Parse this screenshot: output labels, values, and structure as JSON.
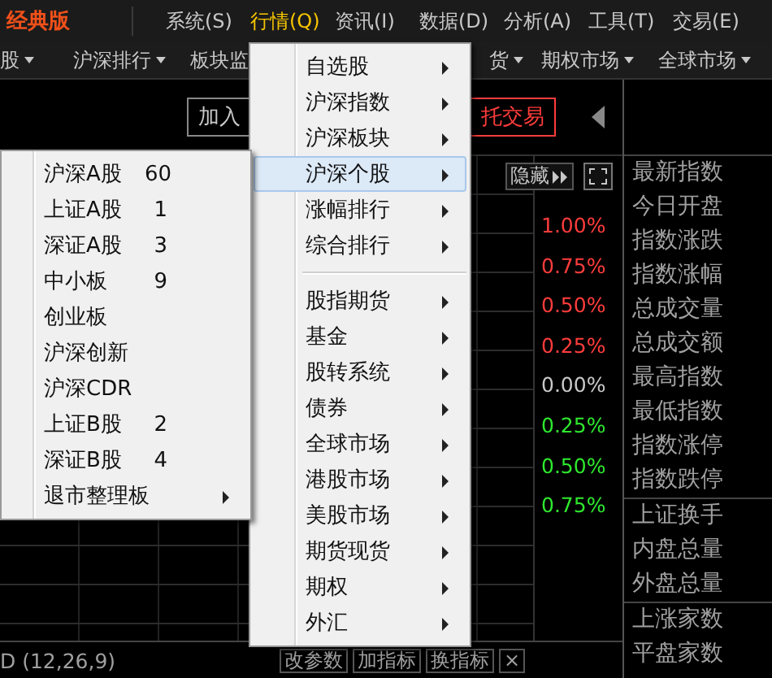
{
  "app": {
    "edition": "经典版"
  },
  "menu_bar": [
    {
      "label": "系统(S)",
      "selected": false
    },
    {
      "label": "行情(Q)",
      "selected": true
    },
    {
      "label": "资讯(I)",
      "selected": false
    },
    {
      "label": "数据(D)",
      "selected": false
    },
    {
      "label": "分析(A)",
      "selected": false
    },
    {
      "label": "工具(T)",
      "selected": false
    },
    {
      "label": "交易(E)",
      "selected": false
    }
  ],
  "toolbar": [
    {
      "label": "股",
      "dropdown": true
    },
    {
      "label": "沪深排行",
      "dropdown": true
    },
    {
      "label": "板块监",
      "dropdown": false
    },
    {
      "label": "货",
      "dropdown": true
    },
    {
      "label": "期权市场",
      "dropdown": true
    },
    {
      "label": "全球市场",
      "dropdown": true
    }
  ],
  "actions": [
    {
      "label": "加入",
      "kind": "plain"
    },
    {
      "label": "托交易",
      "kind": "trade"
    }
  ],
  "chart": {
    "hide_button": "隐藏",
    "axis_labels": [
      {
        "text": "1.00%",
        "color": "#ff3c3c"
      },
      {
        "text": "0.75%",
        "color": "#ff3c3c"
      },
      {
        "text": "0.50%",
        "color": "#ff3c3c"
      },
      {
        "text": "0.25%",
        "color": "#ff3c3c"
      },
      {
        "text": "0.00%",
        "color": "#c8c8c8"
      },
      {
        "text": "0.25%",
        "color": "#2ee82e"
      },
      {
        "text": "0.50%",
        "color": "#2ee82e"
      },
      {
        "text": "0.75%",
        "color": "#2ee82e"
      }
    ],
    "indicator": "D (12,26,9)",
    "indicator_buttons": [
      "改参数",
      "加指标",
      "换指标",
      "×"
    ]
  },
  "side_panel": {
    "groups": [
      [
        "最新指数",
        "今日开盘",
        "指数涨跌",
        "指数涨幅",
        "总成交量",
        "总成交额",
        "最高指数",
        "最低指数",
        "指数涨停",
        "指数跌停"
      ],
      [
        "上证换手",
        "内盘总量",
        "外盘总量"
      ],
      [
        "上涨家数",
        "平盘家数"
      ]
    ]
  },
  "quote_menu": {
    "items": [
      {
        "kind": "item",
        "label": "自选股",
        "selected": false,
        "submenu": true
      },
      {
        "kind": "item",
        "label": "沪深指数",
        "selected": false,
        "submenu": true
      },
      {
        "kind": "item",
        "label": "沪深板块",
        "selected": false,
        "submenu": true
      },
      {
        "kind": "item",
        "label": "沪深个股",
        "selected": true,
        "submenu": true
      },
      {
        "kind": "item",
        "label": "涨幅排行",
        "selected": false,
        "submenu": true
      },
      {
        "kind": "item",
        "label": "综合排行",
        "selected": false,
        "submenu": true
      },
      {
        "kind": "separator"
      },
      {
        "kind": "item",
        "label": "股指期货",
        "selected": false,
        "submenu": true
      },
      {
        "kind": "item",
        "label": "基金",
        "selected": false,
        "submenu": true
      },
      {
        "kind": "item",
        "label": "股转系统",
        "selected": false,
        "submenu": true
      },
      {
        "kind": "item",
        "label": "债券",
        "selected": false,
        "submenu": true
      },
      {
        "kind": "item",
        "label": "全球市场",
        "selected": false,
        "submenu": true
      },
      {
        "kind": "item",
        "label": "港股市场",
        "selected": false,
        "submenu": true
      },
      {
        "kind": "item",
        "label": "美股市场",
        "selected": false,
        "submenu": true
      },
      {
        "kind": "item",
        "label": "期货现货",
        "selected": false,
        "submenu": true
      },
      {
        "kind": "item",
        "label": "期权",
        "selected": false,
        "submenu": true
      },
      {
        "kind": "item",
        "label": "外汇",
        "selected": false,
        "submenu": true
      }
    ]
  },
  "stock_submenu": {
    "items": [
      {
        "label": "沪深A股",
        "hotkey": "60",
        "submenu": false
      },
      {
        "label": "上证A股",
        "hotkey": "1",
        "submenu": false
      },
      {
        "label": "深证A股",
        "hotkey": "3",
        "submenu": false
      },
      {
        "label": "中小板",
        "hotkey": "9",
        "submenu": false
      },
      {
        "label": "创业板",
        "submenu": false
      },
      {
        "label": "沪深创新",
        "submenu": false
      },
      {
        "label": "沪深CDR",
        "submenu": false
      },
      {
        "label": "上证B股",
        "hotkey": "2",
        "submenu": false
      },
      {
        "label": "深证B股",
        "hotkey": "4",
        "submenu": false
      },
      {
        "label": "退市整理板",
        "submenu": true
      }
    ]
  }
}
